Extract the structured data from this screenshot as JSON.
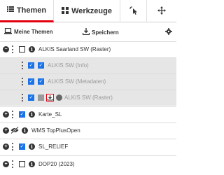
{
  "tabs": {
    "themen": "Themen",
    "werkzeuge": "Werkzeuge"
  },
  "toolbar": {
    "my_themes": "Meine Themen",
    "save": "Speichern"
  },
  "layers": [
    {
      "label": "ALKIS Saarland SW (Raster)"
    },
    {
      "label": "ALKIS SW (Info)"
    },
    {
      "label": "ALKIS SW (Metadaten)"
    },
    {
      "label": "ALKIS SW (Raster)"
    },
    {
      "label": "Karte_SL"
    },
    {
      "label": "WMS TopPlusOpen"
    },
    {
      "label": "SL_RELIEF"
    },
    {
      "label": "DOP20 (2023)"
    }
  ],
  "colors": {
    "accent": "#e3000f",
    "check": "#1a73e8"
  }
}
